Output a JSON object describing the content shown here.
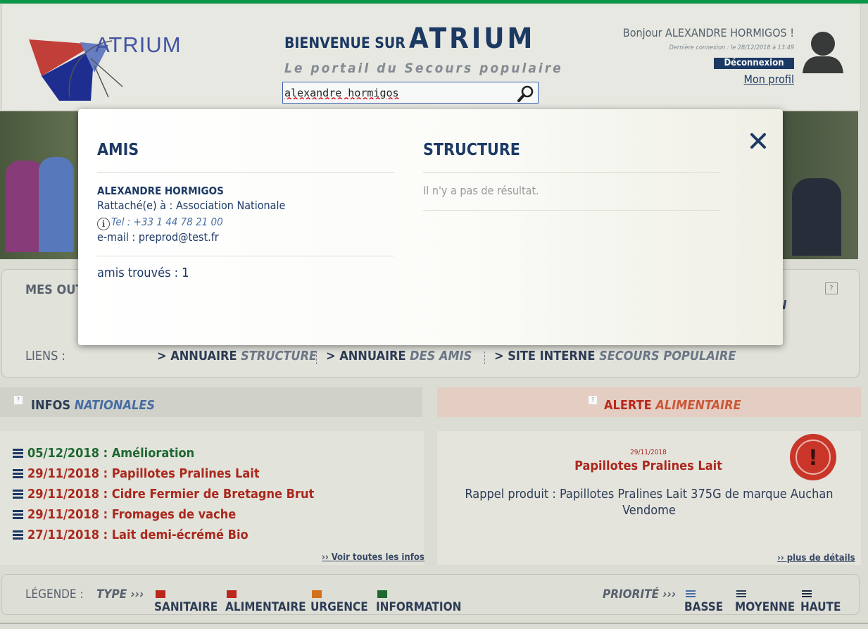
{
  "header": {
    "logo_text": "ATRIUM",
    "welcome_prefix": "BIENVENUE SUR",
    "welcome_brand": "ATRIUM",
    "tagline": "Le portail du Secours populaire",
    "search_value": "alexandre hormigos",
    "greeting": "Bonjour ALEXANDRE HORMIGOS !",
    "last_login": "Dernière connexion : le 28/12/2018 à 13:49",
    "logout_label": "Déconnexion",
    "profile_label": "Mon profil"
  },
  "modal": {
    "friends_title": "AMIS",
    "structure_title": "STRUCTURE",
    "friend": {
      "name": "ALEXANDRE HORMIGOS",
      "attached": "Rattaché(e) à : Association Nationale",
      "tel": "Tel : +33 1 44 78 21 00",
      "email": "e-mail : preprod@test.fr"
    },
    "friends_count": "amis trouvés : 1",
    "structure_empty": "Il n'y a pas de résultat."
  },
  "tools": {
    "title": "MES OUTI",
    "links_label": "LIENS :",
    "links": [
      {
        "prefix": "> ANNUAIRE",
        "suffix": "STRUCTURE"
      },
      {
        "prefix": "> ANNUAIRE",
        "suffix": "DES AMIS"
      },
      {
        "prefix": "> SITE INTERNE",
        "suffix": "SECOURS POPULAIRE"
      }
    ],
    "right_edge_letter": "N"
  },
  "infos": {
    "title": "INFOS",
    "title_em": "NATIONALES",
    "items": [
      {
        "text": "05/12/2018 : Amélioration",
        "color": "#1f6b33"
      },
      {
        "text": "29/11/2018 : Papillotes Pralines Lait",
        "color": "#b0291d"
      },
      {
        "text": "29/11/2018 : Cidre Fermier de Bretagne Brut",
        "color": "#b0291d"
      },
      {
        "text": "29/11/2018 : Fromages de vache",
        "color": "#b0291d"
      },
      {
        "text": "27/11/2018 : Lait demi-écrémé Bio",
        "color": "#b0291d"
      }
    ],
    "more": "›› Voir toutes les infos"
  },
  "alert": {
    "title": "ALERTE",
    "title_em": "ALIMENTAIRE",
    "date": "29/11/2018",
    "headline": "Papillotes Pralines Lait",
    "body": "Rappel produit : Papillotes Pralines Lait 375G de marque Auchan Vendome",
    "more": "›› plus de détails"
  },
  "legend": {
    "label": "LÉGENDE :",
    "type_label": "TYPE ›››",
    "types": [
      {
        "label": "SANITAIRE",
        "color": "#c0281c"
      },
      {
        "label": "ALIMENTAIRE",
        "color": "#c0281c"
      },
      {
        "label": "URGENCE",
        "color": "#d8741c"
      },
      {
        "label": "INFORMATION",
        "color": "#1f6b33"
      }
    ],
    "priority_label": "PRIORITÉ ›››",
    "priorities": [
      "BASSE",
      "MOYENNE",
      "HAUTE"
    ]
  }
}
